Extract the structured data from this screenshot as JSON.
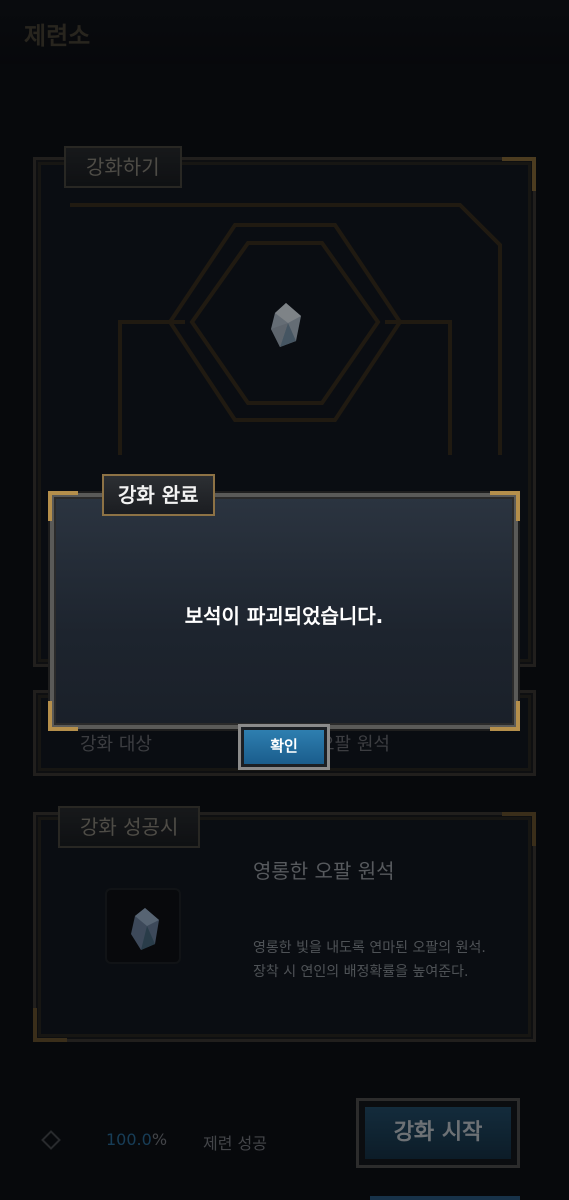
{
  "header": {
    "title": "제련소"
  },
  "enhance_panel": {
    "tab_label": "강화하기"
  },
  "middle_panel": {
    "left_text": "강화 대상",
    "right_text": "오팔 원석"
  },
  "success_panel": {
    "tab_label": "강화 성공시",
    "item_name": "영롱한 오팔 원석",
    "desc_line1": "영롱한 빛을 내도록 연마된 오팔의 원석.",
    "desc_line2": "장착 시 연인의 배정확률을 높여준다."
  },
  "bottom": {
    "rate_value": "100.0",
    "rate_unit": "%",
    "result_label": "제련 성공",
    "start_button": "강화 시작"
  },
  "dialog": {
    "title": "강화 완료",
    "message": "보석이 파괴되었습니다.",
    "confirm_label": "확인"
  },
  "colors": {
    "gold_accent": "#b58f4b",
    "button_blue": "#1a5d8c",
    "rate_blue": "#2b6f9e"
  }
}
